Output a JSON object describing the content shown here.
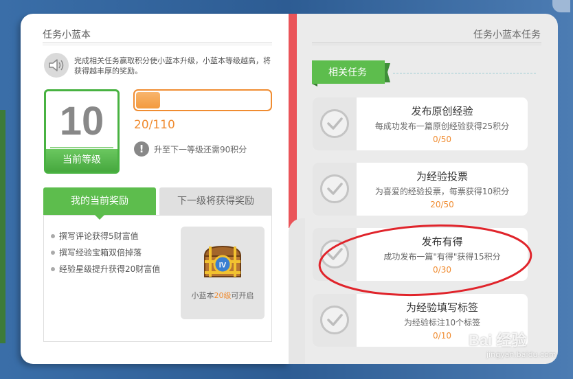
{
  "left_page": {
    "title": "任务小蓝本",
    "intro": "完成相关任务赢取积分使小蓝本升级，小蓝本等级越高，将获得越丰厚的奖励。",
    "level": {
      "number": "10",
      "label": "当前等级"
    },
    "progress": {
      "fraction": 0.18,
      "text": "20/110"
    },
    "hint": {
      "icon_text": "!",
      "text": "升至下一等级还需90积分"
    },
    "tabs": [
      {
        "label": "我的当前奖励",
        "active": true
      },
      {
        "label": "下一级将获得奖励",
        "active": false
      }
    ],
    "rewards": [
      "撰写评论获得5财富值",
      "撰写经验宝箱双倍掉落",
      "经验星级提升获得20财富值"
    ],
    "chest": {
      "caption_prefix": "小蓝本",
      "caption_accent": "20级",
      "caption_suffix": "可开启",
      "badge_text": "IV"
    }
  },
  "right_page": {
    "title": "任务小蓝本任务",
    "section_ribbon": "相关任务",
    "tasks": [
      {
        "title": "发布原创经验",
        "desc": "每成功发布一篇原创经验获得25积分",
        "progress": "0/50"
      },
      {
        "title": "为经验投票",
        "desc": "为喜爱的经验投票，每票获得10积分",
        "progress": "20/50"
      },
      {
        "title": "发布有得",
        "desc": "成功发布一篇\"有得\"获得15积分",
        "progress": "0/30"
      },
      {
        "title": "为经验填写标签",
        "desc": "为经验标注10个标签",
        "progress": "0/10"
      }
    ]
  },
  "watermark": {
    "logo": "Bai 经验",
    "url": "jingyan.baidu.com"
  },
  "colors": {
    "green": "#5dbd4d",
    "orange": "#f08c31",
    "spine_red": "#ea5459",
    "oval_red": "#e0242b",
    "frame_blue": "#2f5f96"
  }
}
